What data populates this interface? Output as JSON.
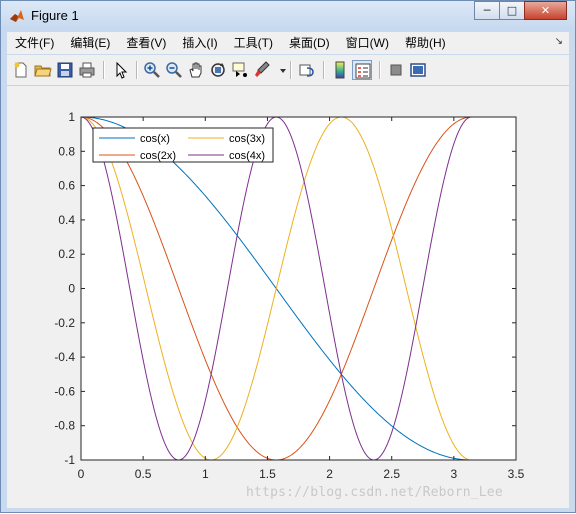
{
  "window": {
    "title": "Figure 1"
  },
  "menu": {
    "items": [
      "文件(F)",
      "编辑(E)",
      "查看(V)",
      "插入(I)",
      "工具(T)",
      "桌面(D)",
      "窗口(W)",
      "帮助(H)"
    ]
  },
  "toolbar": {
    "icons": [
      "new-figure-icon",
      "open-file-icon",
      "save-icon",
      "print-icon",
      "edit-plot-icon",
      "zoom-in-icon",
      "zoom-out-icon",
      "pan-icon",
      "rotate-3d-icon",
      "data-cursor-icon",
      "brush-icon",
      "link-plot-icon",
      "insert-colorbar-icon",
      "insert-legend-icon",
      "hide-plot-tools-icon",
      "show-plot-tools-icon"
    ]
  },
  "chart_data": {
    "type": "line",
    "title": "",
    "xlabel": "",
    "ylabel": "",
    "xlim": [
      0,
      3.5
    ],
    "ylim": [
      -1,
      1
    ],
    "xticks": [
      "0",
      "0.5",
      "1",
      "1.5",
      "2",
      "2.5",
      "3",
      "3.5"
    ],
    "yticks": [
      "1",
      "0.8",
      "0.6",
      "0.4",
      "0.2",
      "0",
      "-0.2",
      "-0.4",
      "-0.6",
      "-0.8",
      "-1"
    ],
    "x_range": [
      0,
      3.1416
    ],
    "series": [
      {
        "name": "cos(x)",
        "frequency": 1,
        "color": "#0072bd"
      },
      {
        "name": "cos(2x)",
        "frequency": 2,
        "color": "#d95319"
      },
      {
        "name": "cos(3x)",
        "frequency": 3,
        "color": "#edb120"
      },
      {
        "name": "cos(4x)",
        "frequency": 4,
        "color": "#7e2f8e"
      }
    ],
    "grid": false,
    "legend": "top-left, two columns"
  },
  "watermark": "https://blog.csdn.net/Reborn_Lee"
}
